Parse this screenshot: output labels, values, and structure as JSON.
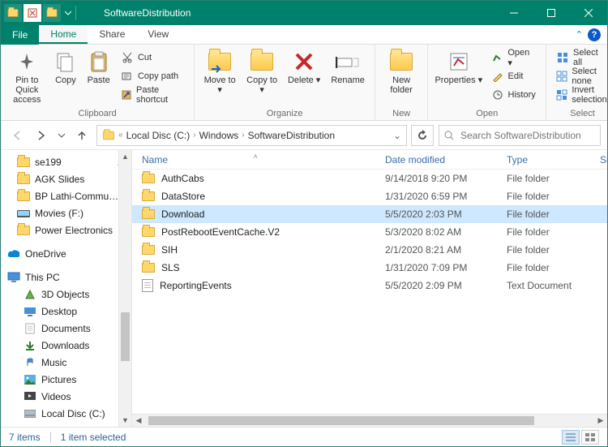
{
  "title": "SoftwareDistribution",
  "tabs": {
    "file": "File",
    "home": "Home",
    "share": "Share",
    "view": "View"
  },
  "ribbon": {
    "clipboard": {
      "label": "Clipboard",
      "pin": "Pin to Quick\naccess",
      "copy": "Copy",
      "paste": "Paste",
      "cut": "Cut",
      "copy_path": "Copy path",
      "paste_shortcut": "Paste shortcut"
    },
    "organize": {
      "label": "Organize",
      "move_to": "Move to ▾",
      "copy_to": "Copy to ▾",
      "delete": "Delete ▾",
      "rename": "Rename"
    },
    "new": {
      "label": "New",
      "new_folder": "New\nfolder"
    },
    "open": {
      "label": "Open",
      "properties": "Properties ▾",
      "open": "Open ▾",
      "edit": "Edit",
      "history": "History"
    },
    "select": {
      "label": "Select",
      "select_all": "Select all",
      "select_none": "Select none",
      "invert": "Invert selection"
    }
  },
  "breadcrumbs": [
    "Local Disc (C:)",
    "Windows",
    "SoftwareDistribution"
  ],
  "search": {
    "placeholder": "Search SoftwareDistribution"
  },
  "nav": {
    "quick": [
      "se199",
      "AGK Slides",
      "BP Lathi-Commu…",
      "Movies (F:)",
      "Power Electronics"
    ],
    "onedrive": "OneDrive",
    "this_pc": "This PC",
    "pc": [
      "3D Objects",
      "Desktop",
      "Documents",
      "Downloads",
      "Music",
      "Pictures",
      "Videos",
      "Local Disc (C:)"
    ]
  },
  "columns": {
    "name": "Name",
    "date": "Date modified",
    "type": "Type",
    "size": "Size"
  },
  "files": [
    {
      "name": "AuthCabs",
      "date": "9/14/2018 9:20 PM",
      "type": "File folder",
      "kind": "folder",
      "selected": false
    },
    {
      "name": "DataStore",
      "date": "1/31/2020 6:59 PM",
      "type": "File folder",
      "kind": "folder",
      "selected": false
    },
    {
      "name": "Download",
      "date": "5/5/2020 2:03 PM",
      "type": "File folder",
      "kind": "folder",
      "selected": true
    },
    {
      "name": "PostRebootEventCache.V2",
      "date": "5/3/2020 8:02 AM",
      "type": "File folder",
      "kind": "folder",
      "selected": false
    },
    {
      "name": "SIH",
      "date": "2/1/2020 8:21 AM",
      "type": "File folder",
      "kind": "folder",
      "selected": false
    },
    {
      "name": "SLS",
      "date": "1/31/2020 7:09 PM",
      "type": "File folder",
      "kind": "folder",
      "selected": false
    },
    {
      "name": "ReportingEvents",
      "date": "5/5/2020 2:09 PM",
      "type": "Text Document",
      "kind": "doc",
      "selected": false
    }
  ],
  "status": {
    "item_count": "7 items",
    "selection": "1 item selected"
  }
}
